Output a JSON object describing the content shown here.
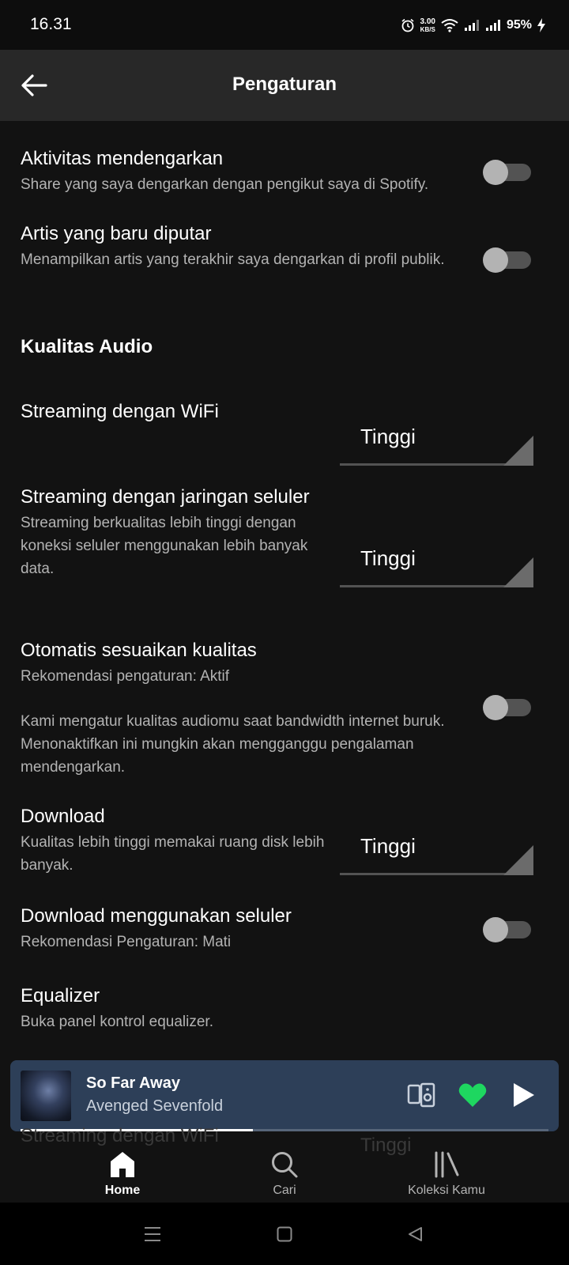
{
  "status_bar": {
    "time": "16.31",
    "net_speed_value": "3.00",
    "net_speed_unit": "KB/S",
    "battery": "95%"
  },
  "header": {
    "title": "Pengaturan",
    "back_icon": "arrow-left-icon"
  },
  "settings": {
    "listening_activity": {
      "title": "Aktivitas mendengarkan",
      "desc": "Share yang saya dengarkan dengan pengikut saya di Spotify.",
      "enabled": false
    },
    "recently_played_artists": {
      "title": "Artis yang baru diputar",
      "desc": "Menampilkan artis yang terakhir saya dengarkan di profil publik.",
      "enabled": false
    },
    "audio_quality_section": "Kualitas Audio",
    "streaming_wifi": {
      "title": "Streaming dengan WiFi",
      "value": "Tinggi"
    },
    "streaming_cellular": {
      "title": "Streaming dengan jaringan seluler",
      "desc": "Streaming berkualitas lebih tinggi dengan koneksi seluler menggunakan lebih banyak data.",
      "value": "Tinggi"
    },
    "auto_adjust_quality": {
      "title": "Otomatis sesuaikan kualitas",
      "recommendation": "Rekomendasi pengaturan: Aktif",
      "desc": "Kami mengatur kualitas audiomu saat bandwidth internet buruk. Menonaktifkan ini mungkin akan mengganggu pengalaman mendengarkan.",
      "enabled": false
    },
    "download": {
      "title": "Download",
      "desc": "Kualitas lebih tinggi memakai ruang disk lebih banyak.",
      "value": "Tinggi"
    },
    "download_cellular": {
      "title": "Download menggunakan seluler",
      "recommendation": "Rekomendasi Pengaturan: Mati",
      "enabled": false
    },
    "equalizer": {
      "title": "Equalizer",
      "desc": "Buka panel kontrol equalizer."
    }
  },
  "mini_player": {
    "track_title": "So Far Away",
    "artist": "Avenged Sevenfold",
    "liked": true,
    "progress_fraction": 0.44,
    "colors": {
      "background": "#2d3f58",
      "heart": "#1ed760"
    }
  },
  "ghost_row": {
    "title": "Streaming dengan WiFi",
    "value": "Tinggi"
  },
  "bottom_nav": {
    "home": "Home",
    "search": "Cari",
    "library": "Koleksi Kamu"
  },
  "colors": {
    "background": "#121212",
    "header": "#282828",
    "accent_green": "#1ed760",
    "secondary_text": "#b3b3b3"
  }
}
